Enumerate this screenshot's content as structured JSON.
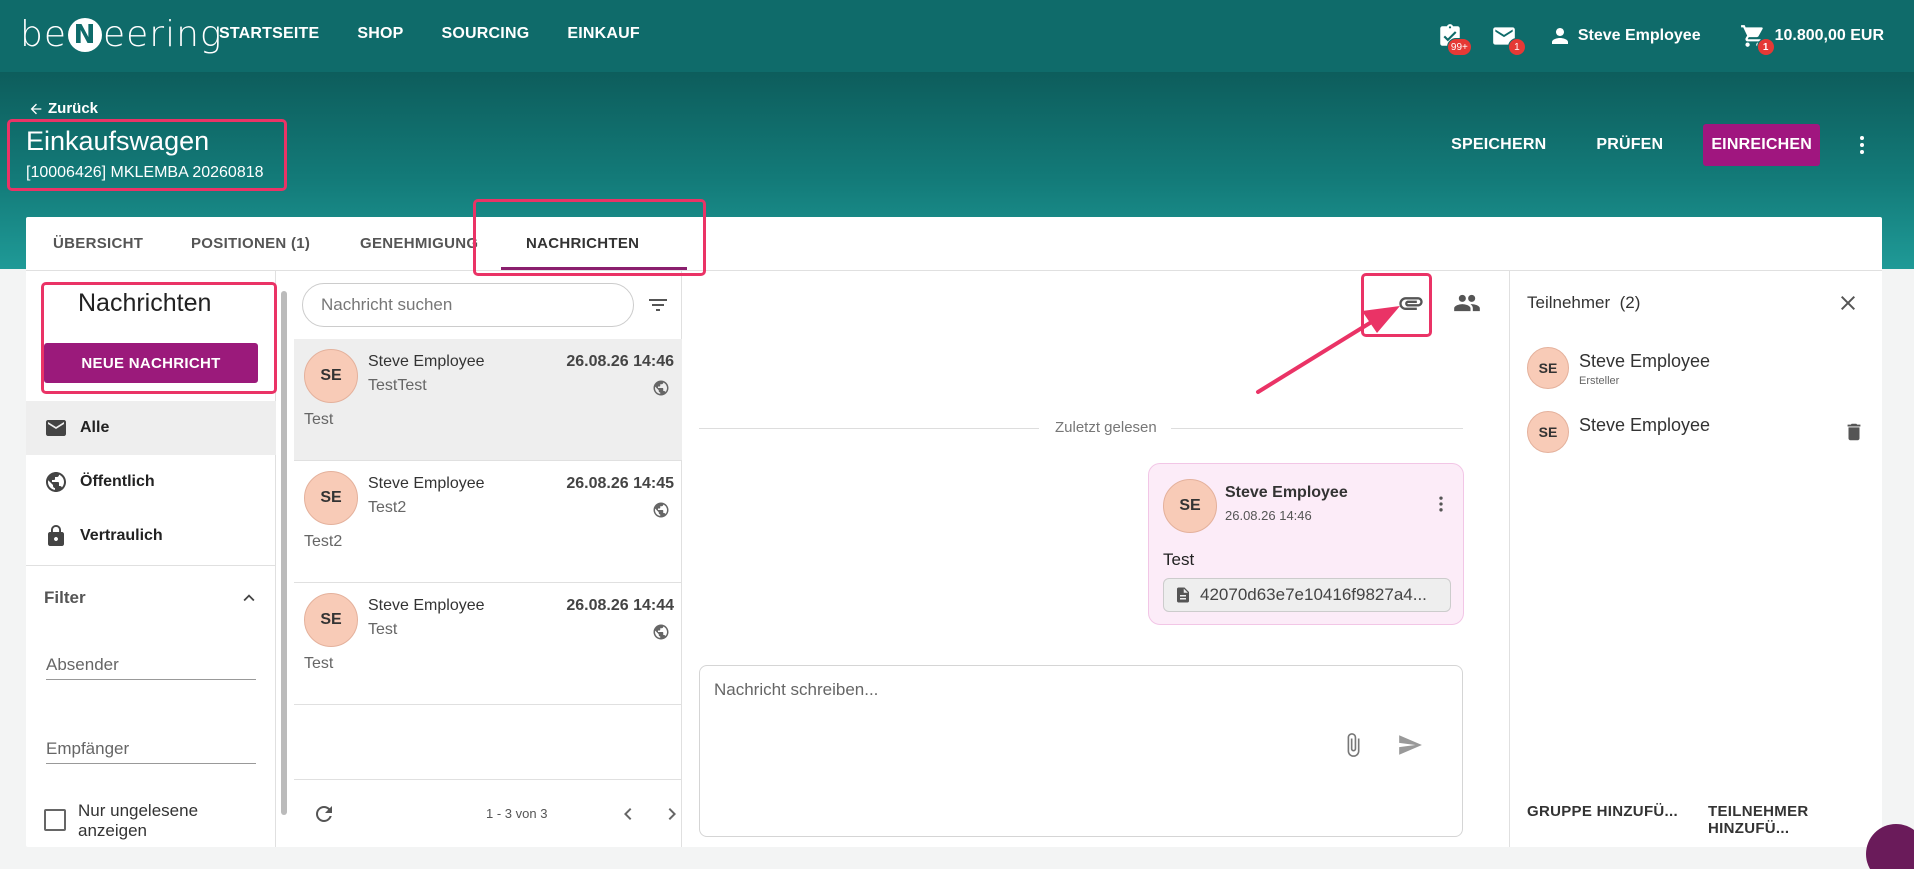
{
  "topbar": {
    "logo_left": "be",
    "logo_n": "N",
    "logo_right": "eering",
    "nav": [
      "STARTSEITE",
      "SHOP",
      "SOURCING",
      "EINKAUF"
    ],
    "tasks_badge": "99+",
    "mail_badge": "1",
    "user_name": "Steve Employee",
    "cart_badge": "1",
    "cart_total": "10.800,00 EUR"
  },
  "header": {
    "back_label": "Zurück",
    "title": "Einkaufswagen",
    "subtitle": "[10006426] MKLEMBA 20260818",
    "actions": {
      "save": "SPEICHERN",
      "check": "PRÜFEN",
      "submit": "EINREICHEN"
    }
  },
  "tabs": [
    {
      "label": "ÜBERSICHT"
    },
    {
      "label": "POSITIONEN (1)"
    },
    {
      "label": "GENEHMIGUNG"
    },
    {
      "label": "NACHRICHTEN",
      "active": true
    }
  ],
  "left_panel": {
    "title": "Nachrichten",
    "new_button": "NEUE NACHRICHT",
    "folders": [
      {
        "label": "Alle",
        "icon": "mail-icon",
        "selected": true
      },
      {
        "label": "Öffentlich",
        "icon": "globe-icon"
      },
      {
        "label": "Vertraulich",
        "icon": "lock-icon"
      }
    ],
    "filter_title": "Filter",
    "sender_placeholder": "Absender",
    "recipient_placeholder": "Empfänger",
    "unread_label_1": "Nur ungelesene",
    "unread_label_2": "anzeigen",
    "unread_checked": false
  },
  "message_list": {
    "search_placeholder": "Nachricht suchen",
    "items": [
      {
        "initials": "SE",
        "sender": "Steve Employee",
        "subject": "TestTest",
        "date": "26.08.26 14:46",
        "preview": "Test",
        "selected": true
      },
      {
        "initials": "SE",
        "sender": "Steve Employee",
        "subject": "Test2",
        "date": "26.08.26 14:45",
        "preview": "Test2"
      },
      {
        "initials": "SE",
        "sender": "Steve Employee",
        "subject": "Test",
        "date": "26.08.26 14:44",
        "preview": "Test"
      }
    ],
    "pagination": "1 - 3 von 3"
  },
  "conversation": {
    "last_read_label": "Zuletzt gelesen",
    "message": {
      "initials": "SE",
      "sender": "Steve Employee",
      "date": "26.08.26 14:46",
      "text": "Test",
      "attachment": "42070d63e7e10416f9827a4..."
    },
    "composer_placeholder": "Nachricht schreiben..."
  },
  "participants": {
    "title": "Teilnehmer",
    "count": "(2)",
    "people": [
      {
        "initials": "SE",
        "name": "Steve Employee",
        "role": "Ersteller"
      },
      {
        "initials": "SE",
        "name": "Steve Employee",
        "role": ""
      }
    ],
    "add_group": "GRUPPE HINZUFÜ...",
    "add_participant": "TEILNEHMER HINZUFÜ..."
  },
  "colors": {
    "topbar": "#0f6b6a",
    "accent": "#9b1a7b",
    "highlight": "#ea3366",
    "avatar": "#f8cbb7"
  }
}
